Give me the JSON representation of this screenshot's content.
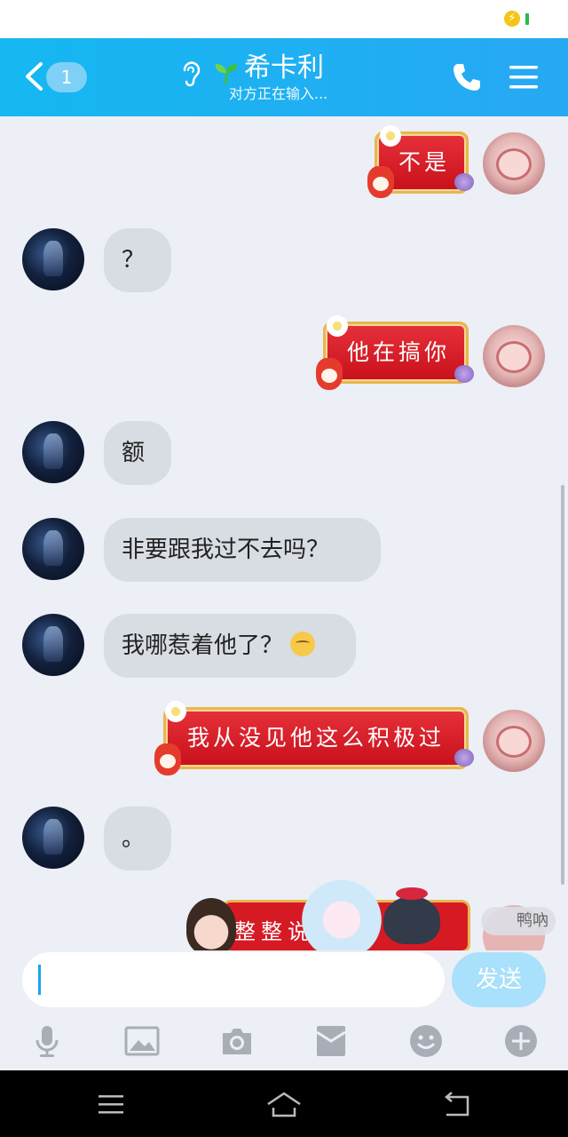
{
  "status_bar": {
    "charging_icon": "lightning-bolt-icon",
    "battery_icon": "battery-icon"
  },
  "header": {
    "unread_count": "1",
    "contact_name": "希卡利",
    "typing_status": "对方正在输入...",
    "colors": {
      "accent": "#1fb4f2"
    }
  },
  "messages": [
    {
      "side": "right",
      "text": "不是",
      "style": "red-festive-bubble"
    },
    {
      "side": "left",
      "text": "？"
    },
    {
      "side": "right",
      "text": "他在搞你",
      "style": "red-festive-bubble"
    },
    {
      "side": "left",
      "text": "额"
    },
    {
      "side": "left",
      "text": "非要跟我过不去吗？"
    },
    {
      "side": "left",
      "text": "我哪惹着他了？",
      "emoji": "sweat-smile-icon"
    },
    {
      "side": "right",
      "text": "我从没见他这么积极过",
      "style": "red-festive-bubble"
    },
    {
      "side": "left",
      "text": "。"
    },
    {
      "side": "right",
      "text": "整整说",
      "partial": true,
      "nickname_badge": "鸭吶"
    }
  ],
  "input": {
    "value": "",
    "send_label": "发送"
  },
  "toolbar": [
    "microphone-icon",
    "image-icon",
    "camera-icon",
    "red-packet-icon",
    "emoji-icon",
    "plus-icon"
  ],
  "nav": [
    "menu-icon",
    "home-icon",
    "back-icon"
  ]
}
